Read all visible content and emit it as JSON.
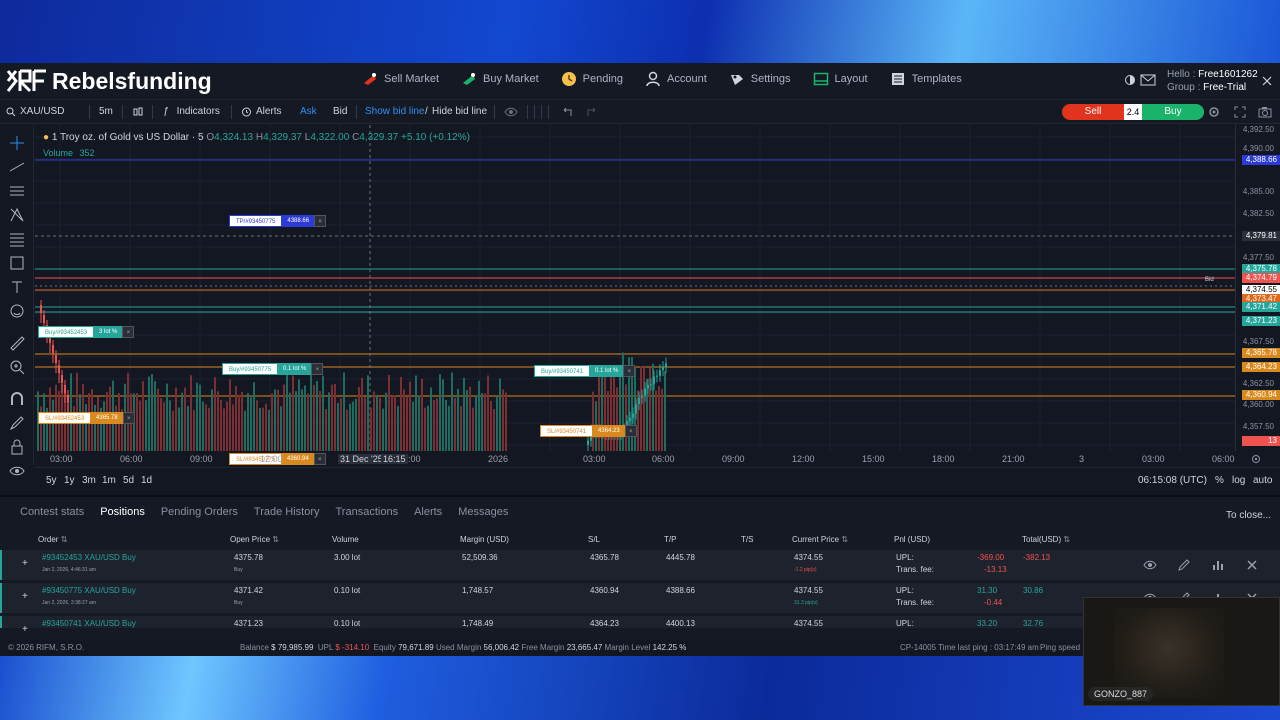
{
  "header": {
    "brand": "Rebelsfunding",
    "nav": [
      {
        "label": "Sell Market",
        "icon": "sell-market-icon"
      },
      {
        "label": "Buy Market",
        "icon": "buy-market-icon"
      },
      {
        "label": "Pending",
        "icon": "pending-icon"
      },
      {
        "label": "Account",
        "icon": "account-icon"
      },
      {
        "label": "Settings",
        "icon": "settings-icon"
      },
      {
        "label": "Layout",
        "icon": "layout-icon"
      },
      {
        "label": "Templates",
        "icon": "templates-icon"
      }
    ],
    "user": {
      "hello": "Hello :",
      "name": "Free1601262",
      "group_label": "Group :",
      "group": "Free-Trial"
    }
  },
  "toolbar": {
    "symbol": "XAU/USD",
    "interval": "5m",
    "indicators": "Indicators",
    "alerts": "Alerts",
    "ask": "Ask",
    "bid": "Bid",
    "show_bid": "Show bid line",
    "slash": "/",
    "hide_bid": "Hide bid line",
    "sell": "Sell",
    "spread": "2.4",
    "buy": "Buy"
  },
  "chart": {
    "title": "1 Troy oz. of Gold vs US Dollar · 5",
    "ohlc": {
      "o_label": "O",
      "o": "4,324.13",
      "h_label": "H",
      "h": "4,329.37",
      "l_label": "L",
      "l": "4,322.00",
      "c_label": "C",
      "c": "4,329.37",
      "change": "+5.10 (+0.12%)"
    },
    "volume_label": "Volume",
    "volume": "352",
    "bid_label": "Bid",
    "price_ticks": [
      "4,392.50",
      "4,390.00",
      "4,385.00",
      "4,382.50",
      "4,377.50",
      "4,367.50",
      "4,362.50",
      "4,360.00",
      "4,357.50"
    ],
    "price_tags": [
      {
        "text": "4,388.66",
        "color": "#2d3bd6"
      },
      {
        "text": "4,379.81",
        "color": "#2a2e39"
      },
      {
        "text": "4,375.78",
        "color": "#26a69a"
      },
      {
        "text": "4,374.79",
        "color": "#ef5350"
      },
      {
        "text": "4,374.55",
        "color": "#ffffff"
      },
      {
        "text": "4,373.47",
        "color": "#e0681c"
      },
      {
        "text": "4,371.42",
        "color": "#26a69a"
      },
      {
        "text": "4,371.23",
        "color": "#26a69a"
      },
      {
        "text": "4,365.78",
        "color": "#d98a1e"
      },
      {
        "text": "4,364.23",
        "color": "#d98a1e"
      },
      {
        "text": "4,360.94",
        "color": "#d98a1e"
      },
      {
        "text": "13",
        "color": "#ef5350"
      }
    ],
    "order_labels": [
      {
        "name": "TP/#93450775",
        "value": "4388.66",
        "color": "#2d3bd6"
      },
      {
        "name": "Buy/#93452453",
        "value": "3 lot %",
        "color": "#26a69a"
      },
      {
        "name": "Buy/#93450775",
        "value": "0.1 lot %",
        "color": "#26a69a"
      },
      {
        "name": "Buy/#93450741",
        "value": "0.1 lot %",
        "color": "#26a69a"
      },
      {
        "name": "SL/#93452453",
        "value": "4365.78",
        "color": "#d98a1e"
      },
      {
        "name": "SL/#93450741",
        "value": "4364.23",
        "color": "#d98a1e"
      },
      {
        "name": "SL/#93450775",
        "value": "4360.94",
        "color": "#d98a1e"
      }
    ],
    "time_ticks": [
      "03:00",
      "06:00",
      "09:00",
      "12:00",
      "31 Dec '25",
      "16:15",
      ":00",
      "2026",
      "03:00",
      "06:00",
      "09:00",
      "12:00",
      "15:00",
      "18:00",
      "21:00",
      "3",
      "03:00",
      "06:00"
    ],
    "ranges": [
      "5y",
      "1y",
      "3m",
      "1m",
      "5d",
      "1d"
    ],
    "clock": "06:15:08 (UTC)",
    "scale_opts": [
      "%",
      "log",
      "auto"
    ]
  },
  "panel": {
    "tabs": [
      "Contest stats",
      "Positions",
      "Pending Orders",
      "Trade History",
      "Transactions",
      "Alerts",
      "Messages"
    ],
    "active_tab": "Positions",
    "close_all": "To close...",
    "columns": [
      "Order",
      "Open Price",
      "Volume",
      "Margin (USD)",
      "S/L",
      "T/P",
      "T/S",
      "Current Price",
      "Pnl (USD)",
      "Total(USD)"
    ],
    "rows": [
      {
        "order": "#93452453 XAU/USD Buy",
        "date": "Jan 2, 2026, 4:46:31 am",
        "open": "4375.78",
        "side": "Buy",
        "volume": "3.00 lot",
        "margin": "52,509.36",
        "sl": "4365.78",
        "tp": "4445.78",
        "ts": "",
        "current": "4374.55",
        "pips": "-1.2 pip(s)",
        "upl_label": "UPL:",
        "upl": "-369.00",
        "fee_label": "Trans. fee:",
        "fee": "-13.13",
        "total": "-382.13"
      },
      {
        "order": "#93450775 XAU/USD Buy",
        "date": "Jan 2, 2026, 3:38:27 am",
        "open": "4371.42",
        "side": "Buy",
        "volume": "0.10 lot",
        "margin": "1,748.57",
        "sl": "4360.94",
        "tp": "4388.66",
        "ts": "",
        "current": "4374.55",
        "pips": "31.3 pip(s)",
        "upl_label": "UPL:",
        "upl": "31.30",
        "fee_label": "Trans. fee:",
        "fee": "-0.44",
        "total": "30.86"
      },
      {
        "order": "#93450741 XAU/USD Buy",
        "date": "",
        "open": "4371.23",
        "side": "",
        "volume": "0.10 lot",
        "margin": "1,748.49",
        "sl": "4364.23",
        "tp": "4400.13",
        "ts": "",
        "current": "4374.55",
        "pips": "",
        "upl_label": "UPL:",
        "upl": "33.20",
        "fee_label": "",
        "fee": "",
        "total": "32.76"
      }
    ]
  },
  "status": {
    "copyright": "© 2026 RIFM, S.R.O.",
    "balance_label": "Balance",
    "balance": "$ 79,985.99",
    "upl_label": "UPL",
    "upl": "$ -314.10",
    "equity_label": "Equity",
    "equity": "79,671.89",
    "used_margin_label": "Used Margin",
    "used_margin": "56,006.42",
    "free_margin_label": "Free Margin",
    "free_margin": "23,665.47",
    "margin_level_label": "Margin Level",
    "margin_level": "142.25 %",
    "server": "CP-14005 Time last ping : 03:17:49 am",
    "ping": "Ping speed :"
  },
  "webcam": {
    "name": "GONZO_887"
  }
}
